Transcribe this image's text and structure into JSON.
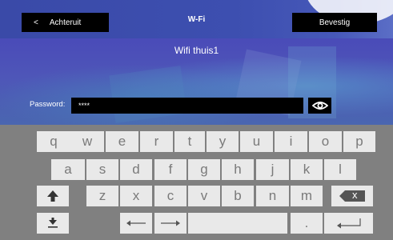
{
  "header": {
    "back_label": "Achteruit",
    "back_chevron": "<",
    "title": "W-Fi",
    "confirm_label": "Bevestig"
  },
  "network": {
    "ssid": "Wifi thuis1"
  },
  "password": {
    "label": "Password:",
    "value": "****",
    "toggle_icon": "eye-icon"
  },
  "keyboard": {
    "row1": [
      "q",
      "w",
      "e",
      "r",
      "t",
      "y",
      "u",
      "i",
      "o",
      "p"
    ],
    "row2": [
      "a",
      "s",
      "d",
      "f",
      "g",
      "h",
      "j",
      "k",
      "l"
    ],
    "row3": [
      "z",
      "x",
      "c",
      "v",
      "b",
      "n",
      "m"
    ],
    "backspace_label": "x",
    "period": ".",
    "icons": [
      "shift-icon",
      "hide-keyboard-icon",
      "arrow-left-icon",
      "arrow-right-icon",
      "enter-icon",
      "backspace-icon"
    ]
  },
  "colors": {
    "header": "#3d4fb0",
    "keyboard_bg": "#808080",
    "key_bg": "#e9e9e9",
    "key_text": "#7a7a7a",
    "field_bg": "#000000"
  }
}
